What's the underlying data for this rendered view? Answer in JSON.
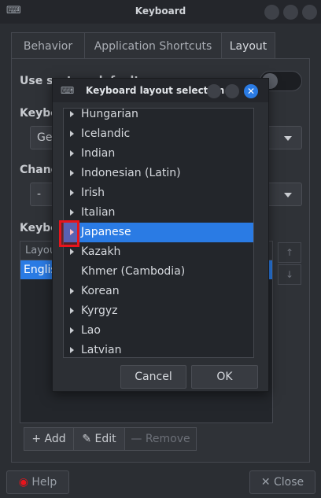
{
  "window": {
    "title": "Keyboard",
    "app_icon": "keyboard-icon",
    "tabs": [
      {
        "label": "Behavior"
      },
      {
        "label": "Application Shortcuts"
      },
      {
        "label": "Layout",
        "active": true
      }
    ]
  },
  "layout_tab": {
    "use_system_defaults_label": "Use system defaults",
    "keyboard_model_label": "Keyboard model",
    "keyboard_model_value": "Generic",
    "change_layout_label": "Change layout option",
    "change_layout_value": "-",
    "keyboard_layout_label": "Keyboard layout",
    "layouts_header": "Layout",
    "layouts": [
      {
        "label": "English"
      }
    ],
    "buttons": {
      "add": "Add",
      "edit": "Edit",
      "remove": "Remove"
    }
  },
  "footer": {
    "help_label": "Help",
    "close_label": "Close"
  },
  "dialog": {
    "title": "Keyboard layout selection",
    "items": [
      {
        "label": "Hungarian",
        "expandable": true
      },
      {
        "label": "Icelandic",
        "expandable": true
      },
      {
        "label": "Indian",
        "expandable": true
      },
      {
        "label": "Indonesian (Latin)",
        "expandable": true
      },
      {
        "label": "Irish",
        "expandable": true
      },
      {
        "label": "Italian",
        "expandable": true
      },
      {
        "label": "Japanese",
        "expandable": true,
        "selected": true
      },
      {
        "label": "Kazakh",
        "expandable": true
      },
      {
        "label": "Khmer (Cambodia)",
        "expandable": false
      },
      {
        "label": "Korean",
        "expandable": true
      },
      {
        "label": "Kyrgyz",
        "expandable": true
      },
      {
        "label": "Lao",
        "expandable": true
      },
      {
        "label": "Latvian",
        "expandable": true
      }
    ],
    "cancel_label": "Cancel",
    "ok_label": "OK"
  },
  "colors": {
    "accent": "#2a7be4",
    "highlight": "#e8141c",
    "background": "#2b2e33"
  }
}
